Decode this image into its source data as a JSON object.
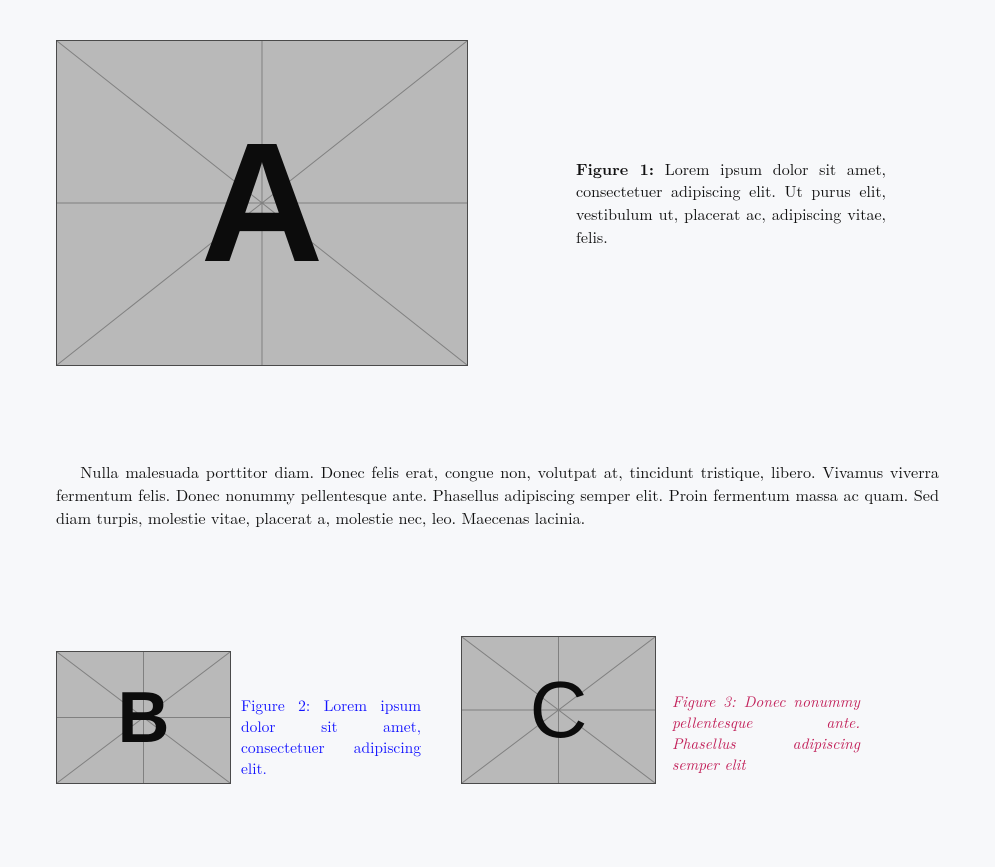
{
  "figures": {
    "fig1": {
      "letter": "A",
      "label": "Figure 1:",
      "caption": "Lorem ipsum dolor sit amet, consectetuer adipiscing elit. Ut purus elit, vestibulum ut, placerat ac, adipiscing vitae, felis."
    },
    "fig2": {
      "letter": "B",
      "label": "Figure 2:",
      "caption": "Lorem ipsum dolor sit amet, consectetuer adipiscing elit."
    },
    "fig3": {
      "letter": "C",
      "label": "Figure 3:",
      "caption": "Donec nonummy pellentesque ante. Phasellus adipiscing semper elit"
    }
  },
  "body_paragraph": "Nulla malesuada porttitor diam. Donec felis erat, congue non, volutpat at, tincidunt tristique, libero. Vivamus viverra fermentum felis. Donec nonummy pellentesque ante. Phasellus adipiscing semper elit. Proin fermentum massa ac quam. Sed diam turpis, molestie vitae, placerat a, molestie nec, leo. Maecenas lacinia."
}
